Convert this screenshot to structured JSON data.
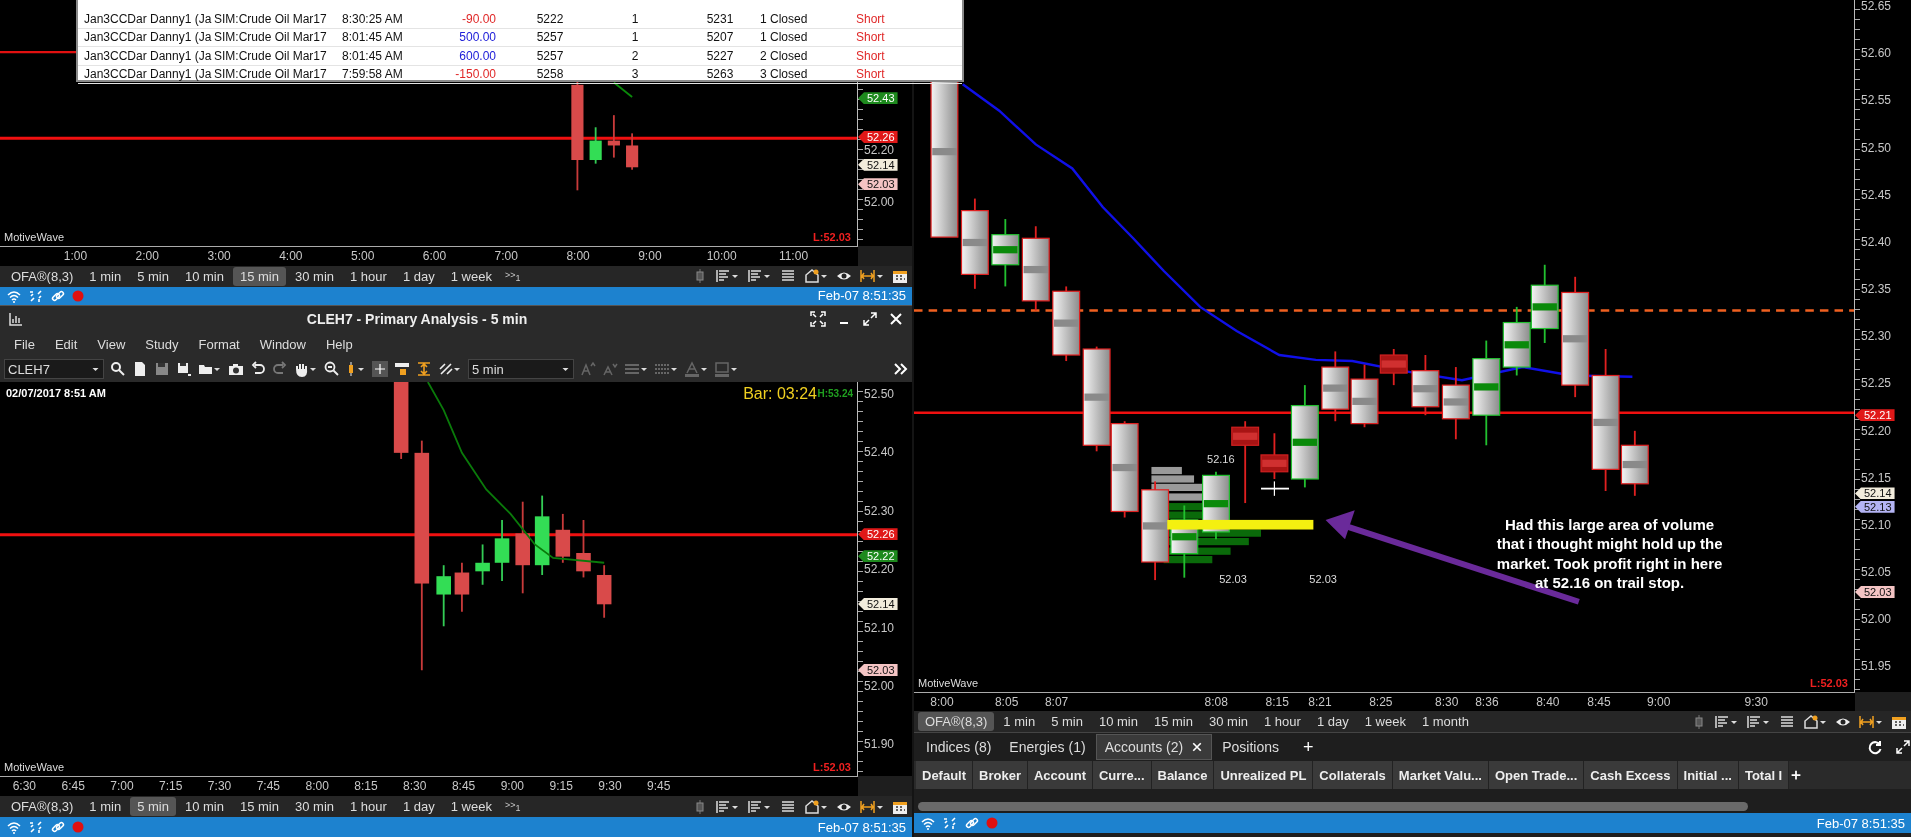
{
  "trades_popup": {
    "rows": [
      {
        "cells": [
          "Jan3CCDar Danny1 (Ja",
          "SIM:Crude Oil Mar17",
          "8:30:25 AM",
          "-90.00",
          "5222",
          "1",
          "5231",
          "1 Closed",
          "Short"
        ],
        "color": "#e02828"
      },
      {
        "cells": [
          "Jan3CCDar Danny1 (Ja",
          "SIM:Crude Oil Mar17",
          "8:01:45 AM",
          "500.00",
          "5257",
          "1",
          "5207",
          "1 Closed",
          "Short"
        ],
        "color": "#2020d8"
      },
      {
        "cells": [
          "Jan3CCDar Danny1 (Ja",
          "SIM:Crude Oil Mar17",
          "8:01:45 AM",
          "600.00",
          "5257",
          "2",
          "5227",
          "2 Closed",
          "Short"
        ],
        "color": "#2020d8"
      },
      {
        "cells": [
          "Jan3CCDar Danny1 (Ja",
          "SIM:Crude Oil Mar17",
          "7:59:58 AM",
          "-150.00",
          "5258",
          "3",
          "5263",
          "3 Closed",
          "Short"
        ],
        "color": "#e02828"
      }
    ]
  },
  "top_chart": {
    "watermark": "MotiveWave",
    "last_label": "L:52.03",
    "price_ticks": [
      "52.20",
      "52.00"
    ],
    "price_tags": [
      {
        "label": "52.43",
        "color": "#1e8a1e"
      },
      {
        "label": "52.26",
        "color": "#e01818"
      },
      {
        "label": "52.14",
        "color": "#f2ecdc"
      },
      {
        "label": "52.03",
        "color": "#f4c4c4"
      }
    ],
    "time_ticks": [
      "1:00",
      "2:00",
      "3:00",
      "4:00",
      "5:00",
      "6:00",
      "7:00",
      "8:00",
      "9:00",
      "10:00",
      "11:00"
    ],
    "toolbar": {
      "items": [
        {
          "label": "OFA®(8,3)",
          "selected": false
        },
        {
          "label": "1 min",
          "selected": false
        },
        {
          "label": "5 min",
          "selected": false
        },
        {
          "label": "10 min",
          "selected": false
        },
        {
          "label": "15 min",
          "selected": true
        },
        {
          "label": "30 min",
          "selected": false
        },
        {
          "label": "1 hour",
          "selected": false
        },
        {
          "label": "1 day",
          "selected": false
        },
        {
          "label": "1 week",
          "selected": false
        }
      ],
      "more": ">>",
      "more_count": "1"
    },
    "status_bar": {
      "time": "Feb-07 8:51:35"
    }
  },
  "analysis_window": {
    "title": "CLEH7 - Primary Analysis - 5 min",
    "menu": [
      "File",
      "Edit",
      "View",
      "Study",
      "Format",
      "Window",
      "Help"
    ],
    "symbol": "CLEH7",
    "interval": "5 min",
    "date": "02/07/2017 8:51 AM",
    "bar_timer": "Bar: 03:24",
    "high_label": "H:53.24",
    "chart": {
      "watermark": "MotiveWave",
      "last_label": "L:52.03",
      "price_ticks": [
        "52.50",
        "52.40",
        "52.30",
        "52.20",
        "52.10",
        "52.00",
        "51.90"
      ],
      "price_tags": [
        {
          "label": "52.26",
          "color": "#e01818"
        },
        {
          "label": "52.22",
          "color": "#1e8a1e"
        },
        {
          "label": "52.14",
          "color": "#f2ecdc"
        },
        {
          "label": "52.03",
          "color": "#f4c4c4"
        }
      ],
      "time_ticks": [
        "6:30",
        "6:45",
        "7:00",
        "7:15",
        "7:30",
        "7:45",
        "8:00",
        "8:15",
        "8:30",
        "8:45",
        "9:00",
        "9:15",
        "9:30",
        "9:45"
      ]
    },
    "toolbar": {
      "items": [
        {
          "label": "OFA®(8,3)",
          "selected": false
        },
        {
          "label": "1 min",
          "selected": false
        },
        {
          "label": "5 min",
          "selected": true
        },
        {
          "label": "10 min",
          "selected": false
        },
        {
          "label": "15 min",
          "selected": false
        },
        {
          "label": "30 min",
          "selected": false
        },
        {
          "label": "1 hour",
          "selected": false
        },
        {
          "label": "1 day",
          "selected": false
        },
        {
          "label": "1 week",
          "selected": false
        }
      ],
      "more": ">>",
      "more_count": "1"
    },
    "status_bar": {
      "time": "Feb-07 8:51:35"
    }
  },
  "right_chart": {
    "watermark": "MotiveWave",
    "last_label": "L:52.03",
    "price_ticks": [
      "52.65",
      "52.60",
      "52.55",
      "52.50",
      "52.45",
      "52.40",
      "52.35",
      "52.30",
      "52.25",
      "52.20",
      "52.15",
      "52.10",
      "52.05",
      "52.00",
      "51.95"
    ],
    "price_tags": [
      {
        "label": "52.21",
        "color": "#e01818"
      },
      {
        "label": "52.14",
        "color": "#f2ecdc"
      },
      {
        "label": "52.13",
        "color": "#b4b4f4"
      },
      {
        "label": "52.03",
        "color": "#f4c4c4"
      }
    ],
    "time_ticks": [
      "8:00",
      "8:05",
      "8:07",
      "8:08",
      "8:15",
      "8:21",
      "8:25",
      "8:30",
      "8:36",
      "8:40",
      "8:45",
      "9:00",
      "9:30"
    ],
    "labels": [
      "52.16",
      "52.03",
      "52.03"
    ],
    "note": "Had this large area of volume that i thought might hold up the market. Took profit right in here at 52.16 on trail stop.",
    "toolbar": {
      "items": [
        {
          "label": "OFA®(8,3)",
          "selected": true
        },
        {
          "label": "1 min",
          "selected": false
        },
        {
          "label": "5 min",
          "selected": false
        },
        {
          "label": "10 min",
          "selected": false
        },
        {
          "label": "15 min",
          "selected": false
        },
        {
          "label": "30 min",
          "selected": false
        },
        {
          "label": "1 hour",
          "selected": false
        },
        {
          "label": "1 day",
          "selected": false
        },
        {
          "label": "1 week",
          "selected": false
        },
        {
          "label": "1 month",
          "selected": false
        }
      ]
    }
  },
  "accounts_panel": {
    "tabs": [
      {
        "label": "Indices (8)",
        "selected": false,
        "closable": false
      },
      {
        "label": "Energies (1)",
        "selected": false,
        "closable": false
      },
      {
        "label": "Accounts (2)",
        "selected": true,
        "closable": true
      },
      {
        "label": "Positions",
        "selected": false,
        "closable": false
      }
    ],
    "add_tab": "+",
    "columns": [
      "Default",
      "Broker",
      "Account",
      "Curre...",
      "Balance",
      "Unrealized PL",
      "Collaterals",
      "Market Valu...",
      "Open Trade...",
      "Cash Excess",
      "Initial ...",
      "Total I"
    ],
    "status_bar": {
      "time": "Feb-07 8:51:35"
    }
  }
}
